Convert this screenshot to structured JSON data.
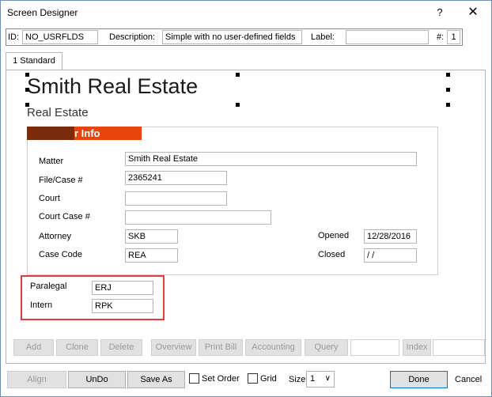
{
  "window": {
    "title": "Screen Designer",
    "help": "?",
    "close": "✕"
  },
  "header": {
    "id_label": "ID:",
    "id_value": "NO_USRFLDS",
    "description_label": "Description:",
    "description_value": "Simple with no user-defined fields",
    "label_label": "Label:",
    "label_value": "",
    "num_label": "#:",
    "num_value": "1"
  },
  "tabs": [
    {
      "label": "1 Standard"
    }
  ],
  "form": {
    "title": "Smith Real Estate",
    "subtitle": "Real Estate",
    "group_header": "r Info",
    "fields": {
      "matter": {
        "label": "Matter",
        "value": "Smith Real Estate"
      },
      "file_case": {
        "label": "File/Case #",
        "value": "2365241"
      },
      "court": {
        "label": "Court",
        "value": ""
      },
      "court_case": {
        "label": "Court Case #",
        "value": ""
      },
      "attorney": {
        "label": "Attorney",
        "value": "SKB"
      },
      "case_code": {
        "label": "Case Code",
        "value": "REA"
      },
      "opened": {
        "label": "Opened",
        "value": "12/28/2016"
      },
      "closed": {
        "label": "Closed",
        "value": " /  /"
      },
      "paralegal": {
        "label": "Paralegal",
        "value": "ERJ"
      },
      "intern": {
        "label": "Intern",
        "value": "RPK"
      }
    }
  },
  "record_buttons": {
    "add": "Add",
    "clone": "Clone",
    "delete": "Delete",
    "overview": "Overview",
    "print_bill": "Print Bill",
    "accounting": "Accounting",
    "query": "Query",
    "index": "Index"
  },
  "footer": {
    "align": "Align",
    "undo": "UnDo",
    "save_as": "Save As",
    "set_order": "Set Order",
    "grid": "Grid",
    "size_label": "Size",
    "size_value": "1",
    "done": "Done",
    "cancel": "Cancel"
  },
  "colors": {
    "group_header_dark": "#7b2c0c",
    "group_header_orange": "#e8440c",
    "highlight_box": "#e63b3b"
  }
}
